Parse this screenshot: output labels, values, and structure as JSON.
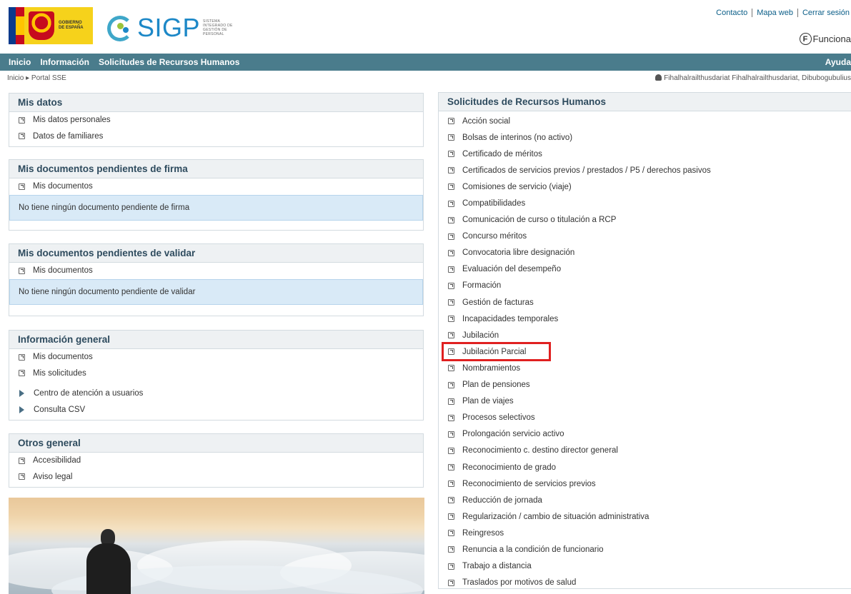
{
  "header": {
    "gov_text": [
      "GOBIERNO",
      "DE ESPAÑA"
    ],
    "sigp_word": "SIGP",
    "sigp_sub": [
      "SISTEMA",
      "INTEGRADO DE",
      "GESTIÓN DE",
      "PERSONAL"
    ],
    "top_links": [
      "Contacto",
      "Mapa web",
      "Cerrar sesión"
    ],
    "funciona_badge": "F",
    "funciona_label": "Funciona"
  },
  "nav": {
    "items": [
      "Inicio",
      "Información",
      "Solicitudes de Recursos Humanos"
    ],
    "help": "Ayuda"
  },
  "breadcrumb": "Inicio ▸ Portal SSE",
  "user": "Fihalhalrailthusdariat Fihalhalrailthusdariat, Dibubogubulius",
  "mis_datos": {
    "title": "Mis datos",
    "links": [
      "Mis datos personales",
      "Datos de familiares"
    ]
  },
  "pend_firma": {
    "title": "Mis documentos pendientes de firma",
    "link": "Mis documentos",
    "notice": "No tiene ningún documento pendiente de firma"
  },
  "pend_validar": {
    "title": "Mis documentos pendientes de validar",
    "link": "Mis documentos",
    "notice": "No tiene ningún documento pendiente de validar"
  },
  "info_general": {
    "title": "Información general",
    "links": [
      "Mis documentos",
      "Mis solicitudes"
    ],
    "expand_links": [
      "Centro de atención a usuarios",
      "Consulta CSV"
    ]
  },
  "otros": {
    "title": "Otros general",
    "links": [
      "Accesibilidad",
      "Aviso legal"
    ]
  },
  "solicitudes": {
    "title": "Solicitudes de Recursos Humanos",
    "links": [
      "Acción social",
      "Bolsas de interinos (no activo)",
      "Certificado de méritos",
      "Certificados de servicios previos / prestados / P5 / derechos pasivos",
      "Comisiones de servicio (viaje)",
      "Compatibilidades",
      "Comunicación de curso o titulación a RCP",
      "Concurso méritos",
      "Convocatoria libre designación",
      "Evaluación del desempeño",
      "Formación",
      "Gestión de facturas",
      "Incapacidades temporales",
      "Jubilación",
      "Jubilación Parcial",
      "Nombramientos",
      "Plan de pensiones",
      "Plan de viajes",
      "Procesos selectivos",
      "Prolongación servicio activo",
      "Reconocimiento c. destino director general",
      "Reconocimiento de grado",
      "Reconocimiento de servicios previos",
      "Reducción de jornada",
      "Regularización / cambio de situación administrativa",
      "Reingresos",
      "Renuncia a la condición de funcionario",
      "Trabajo a distancia",
      "Traslados por motivos de salud"
    ]
  }
}
